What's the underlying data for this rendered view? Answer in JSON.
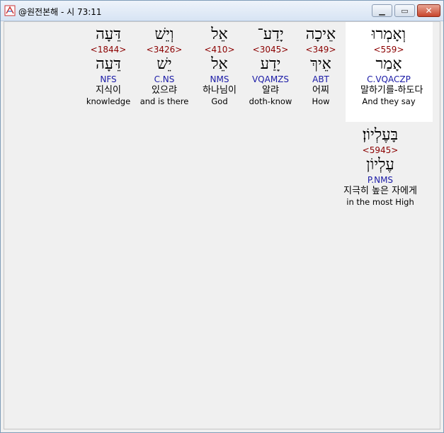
{
  "window": {
    "title": "@원전본해 - 시 73:11",
    "min_glyph": "▁",
    "max_glyph": "▭",
    "close_glyph": "✕"
  },
  "words": [
    {
      "hebrew": "וְאָמְרוּ",
      "strong": "<559>",
      "lemma": "אָמַר",
      "parse": "C.VQACZP",
      "korean": "말하기를-하도다",
      "english": "And they say"
    },
    {
      "hebrew": "אֵיכָה",
      "strong": "<349>",
      "lemma": "אֵיךְ",
      "parse": "ABT",
      "korean": "어찌",
      "english": "How"
    },
    {
      "hebrew": "יָדַע־",
      "strong": "<3045>",
      "lemma": "יָדַע",
      "parse": "VQAMZS",
      "korean": "알랴",
      "english": "doth-know"
    },
    {
      "hebrew": "אֵל",
      "strong": "<410>",
      "lemma": "אֵל",
      "parse": "NMS",
      "korean": "하나님이",
      "english": "God"
    },
    {
      "hebrew": "וְיֵשׁ",
      "strong": "<3426>",
      "lemma": "יֵשׁ",
      "parse": "C.NS",
      "korean": "있으랴",
      "english": "and is there"
    },
    {
      "hebrew": "דֵּעָה",
      "strong": "<1844>",
      "lemma": "דֵּעָה",
      "parse": "NFS",
      "korean": "지식이",
      "english": "knowledge"
    },
    {
      "hebrew": "בָּעֶלְיוֹן׃",
      "strong": "<5945>",
      "lemma": "עֶלְיוֹן",
      "parse": "P.NMS",
      "korean": "지극히 높은 자에게",
      "english": "in the most High"
    }
  ]
}
